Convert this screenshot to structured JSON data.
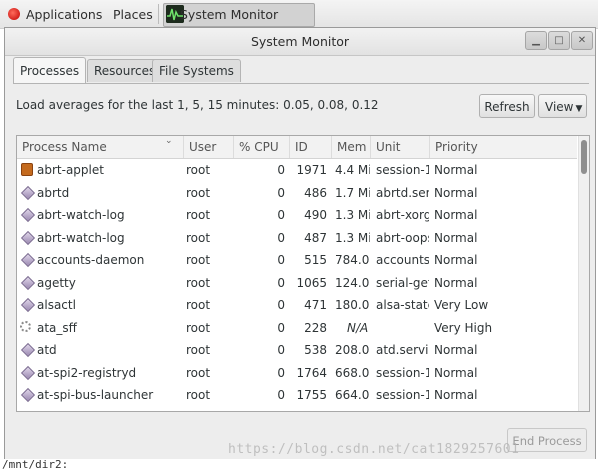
{
  "top_panel": {
    "applications_label": "Applications",
    "places_label": "Places",
    "task_label": "System Monitor"
  },
  "window": {
    "title": "System Monitor"
  },
  "tabs": [
    {
      "label": "Processes",
      "active": true
    },
    {
      "label": "Resources",
      "active": false
    },
    {
      "label": "File Systems",
      "active": false
    }
  ],
  "load_averages_text": "Load averages for the last 1, 5, 15 minutes: 0.05, 0.08, 0.12",
  "buttons": {
    "refresh": "Refresh",
    "view": "View",
    "end_process": "End Process"
  },
  "columns": [
    "Process Name",
    "User",
    "% CPU",
    "ID",
    "Mem",
    "Unit",
    "Priority"
  ],
  "processes": [
    {
      "name": "abrt-applet",
      "user": "root",
      "cpu": "0",
      "id": "1971",
      "mem": "4.4 Mi",
      "unit": "session-1",
      "priority": "Normal",
      "icon": "app-icon"
    },
    {
      "name": "abrtd",
      "user": "root",
      "cpu": "0",
      "id": "486",
      "mem": "1.7 Mi",
      "unit": "abrtd.serv",
      "priority": "Normal",
      "icon": "process-icon"
    },
    {
      "name": "abrt-watch-log",
      "user": "root",
      "cpu": "0",
      "id": "490",
      "mem": "1.3 Mi",
      "unit": "abrt-xorg",
      "priority": "Normal",
      "icon": "process-icon"
    },
    {
      "name": "abrt-watch-log",
      "user": "root",
      "cpu": "0",
      "id": "487",
      "mem": "1.3 Mi",
      "unit": "abrt-oops",
      "priority": "Normal",
      "icon": "process-icon"
    },
    {
      "name": "accounts-daemon",
      "user": "root",
      "cpu": "0",
      "id": "515",
      "mem": "784.0",
      "unit": "accounts-",
      "priority": "Normal",
      "icon": "process-icon"
    },
    {
      "name": "agetty",
      "user": "root",
      "cpu": "0",
      "id": "1065",
      "mem": "124.0",
      "unit": "serial-get",
      "priority": "Normal",
      "icon": "process-icon"
    },
    {
      "name": "alsactl",
      "user": "root",
      "cpu": "0",
      "id": "471",
      "mem": "180.0",
      "unit": "alsa-state",
      "priority": "Very Low",
      "icon": "process-icon"
    },
    {
      "name": "ata_sff",
      "user": "root",
      "cpu": "0",
      "id": "228",
      "mem": "N/A",
      "unit": "",
      "priority": "Very High",
      "icon": "gear-icon"
    },
    {
      "name": "atd",
      "user": "root",
      "cpu": "0",
      "id": "538",
      "mem": "208.0",
      "unit": "atd.servic",
      "priority": "Normal",
      "icon": "process-icon"
    },
    {
      "name": "at-spi2-registryd",
      "user": "root",
      "cpu": "0",
      "id": "1764",
      "mem": "668.0",
      "unit": "session-1",
      "priority": "Normal",
      "icon": "process-icon"
    },
    {
      "name": "at-spi-bus-launcher",
      "user": "root",
      "cpu": "0",
      "id": "1755",
      "mem": "664.0",
      "unit": "session-1",
      "priority": "Normal",
      "icon": "process-icon"
    }
  ],
  "watermark": "https://blog.csdn.net/cat1829257601",
  "terminal_text": "/mnt/dir2:"
}
